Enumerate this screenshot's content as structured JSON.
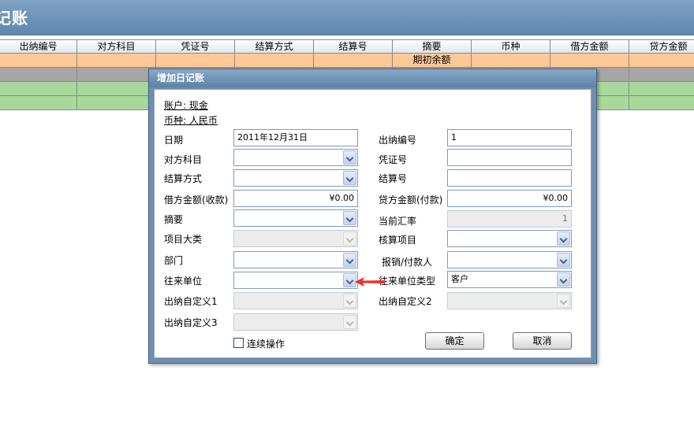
{
  "window": {
    "title": "记账"
  },
  "grid": {
    "headers": [
      "出纳编号",
      "对方科目",
      "凭证号",
      "结算方式",
      "结算号",
      "摘要",
      "币种",
      "借方金额",
      "贷方金额"
    ],
    "opening_row_label": "期初余额"
  },
  "dialog": {
    "title": "增加日记账",
    "account_info": "账户: 现金",
    "currency_info": "币种: 人民币",
    "labels": {
      "date": "日期",
      "counter_account": "对方科目",
      "settlement_method": "结算方式",
      "debit_amount": "借方金额(收款)",
      "summary": "摘要",
      "project_category": "项目大类",
      "department": "部门",
      "partner": "往来单位",
      "custom1": "出纳自定义1",
      "custom3": "出纳自定义3",
      "cashier_number": "出纳编号",
      "voucher_number": "凭证号",
      "settlement_number": "结算号",
      "credit_amount": "贷方金额(付款)",
      "exchange_rate": "当前汇率",
      "accounting_item": "核算项目",
      "payee": "报销/付款人",
      "partner_type": "往来单位类型",
      "custom2": "出纳自定义2",
      "continuous": "连续操作"
    },
    "values": {
      "date": "2011年12月31日",
      "cashier_number": "1",
      "debit_amount": "¥0.00",
      "credit_amount": "¥0.00",
      "exchange_rate": "1",
      "partner_type": "客户"
    },
    "buttons": {
      "ok": "确定",
      "cancel": "取消"
    }
  },
  "colors": {
    "title_bar": "#6a8fb3",
    "header_row": "#eef2f6",
    "opening_row": "#ffc896",
    "gray_row": "#a6a6a6",
    "green_row": "#a8d89c",
    "arrow": "#e8322a"
  }
}
